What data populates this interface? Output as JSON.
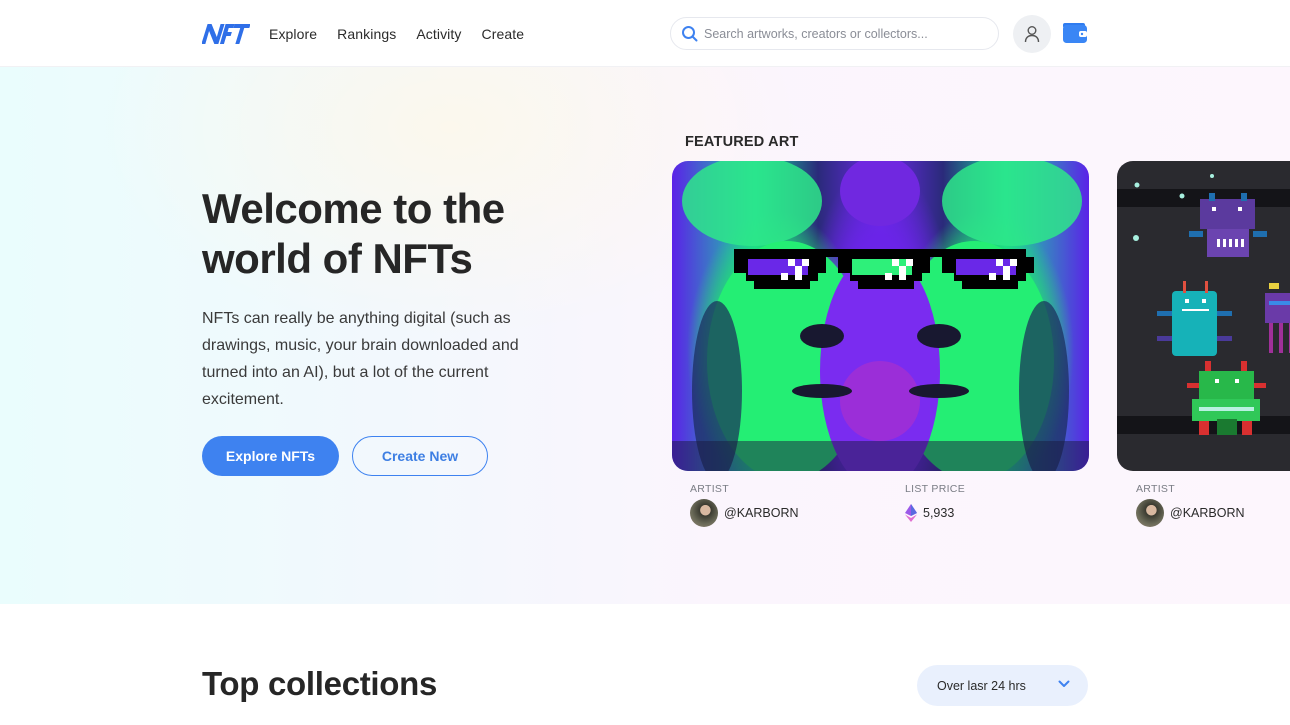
{
  "header": {
    "logo_text": "NFT",
    "nav": [
      {
        "label": "Explore"
      },
      {
        "label": "Rankings"
      },
      {
        "label": "Activity"
      },
      {
        "label": "Create"
      }
    ],
    "search": {
      "placeholder": "Search artworks, creators or collectors...",
      "value": ""
    },
    "icons": {
      "search": "search-icon",
      "user": "user-icon",
      "wallet": "wallet-icon"
    }
  },
  "hero": {
    "title_line1": "Welcome to the",
    "title_line2": "world of NFTs",
    "description": "NFTs can really be anything digital (such as drawings, music, your brain downloaded and turned into an AI), but a lot of the current excitement.",
    "primary_button": "Explore NFTs",
    "secondary_button": "Create New"
  },
  "featured": {
    "label": "FEATURED ART",
    "cards": [
      {
        "artist_label": "ARTIST",
        "artist": "@KARBORN",
        "price_label": "LIST PRICE",
        "price": "5,933",
        "currency_icon": "ethereum-icon"
      },
      {
        "artist_label": "ARTIST",
        "artist": "@KARBORN"
      }
    ]
  },
  "top_collections": {
    "title": "Top collections",
    "period_selected": "Over lasr 24 hrs"
  },
  "colors": {
    "accent": "#3e82f0",
    "text_dark": "#262626",
    "dropdown_bg": "#e9f0fd"
  }
}
